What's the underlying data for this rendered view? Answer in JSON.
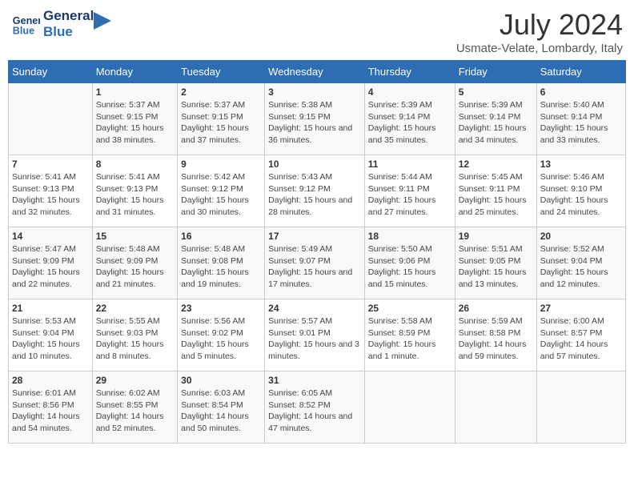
{
  "header": {
    "logo_line1": "General",
    "logo_line2": "Blue",
    "title": "July 2024",
    "subtitle": "Usmate-Velate, Lombardy, Italy"
  },
  "weekdays": [
    "Sunday",
    "Monday",
    "Tuesday",
    "Wednesday",
    "Thursday",
    "Friday",
    "Saturday"
  ],
  "weeks": [
    [
      {
        "day": "",
        "content": ""
      },
      {
        "day": "1",
        "content": "Sunrise: 5:37 AM\nSunset: 9:15 PM\nDaylight: 15 hours\nand 38 minutes."
      },
      {
        "day": "2",
        "content": "Sunrise: 5:37 AM\nSunset: 9:15 PM\nDaylight: 15 hours\nand 37 minutes."
      },
      {
        "day": "3",
        "content": "Sunrise: 5:38 AM\nSunset: 9:15 PM\nDaylight: 15 hours\nand 36 minutes."
      },
      {
        "day": "4",
        "content": "Sunrise: 5:39 AM\nSunset: 9:14 PM\nDaylight: 15 hours\nand 35 minutes."
      },
      {
        "day": "5",
        "content": "Sunrise: 5:39 AM\nSunset: 9:14 PM\nDaylight: 15 hours\nand 34 minutes."
      },
      {
        "day": "6",
        "content": "Sunrise: 5:40 AM\nSunset: 9:14 PM\nDaylight: 15 hours\nand 33 minutes."
      }
    ],
    [
      {
        "day": "7",
        "content": "Sunrise: 5:41 AM\nSunset: 9:13 PM\nDaylight: 15 hours\nand 32 minutes."
      },
      {
        "day": "8",
        "content": "Sunrise: 5:41 AM\nSunset: 9:13 PM\nDaylight: 15 hours\nand 31 minutes."
      },
      {
        "day": "9",
        "content": "Sunrise: 5:42 AM\nSunset: 9:12 PM\nDaylight: 15 hours\nand 30 minutes."
      },
      {
        "day": "10",
        "content": "Sunrise: 5:43 AM\nSunset: 9:12 PM\nDaylight: 15 hours\nand 28 minutes."
      },
      {
        "day": "11",
        "content": "Sunrise: 5:44 AM\nSunset: 9:11 PM\nDaylight: 15 hours\nand 27 minutes."
      },
      {
        "day": "12",
        "content": "Sunrise: 5:45 AM\nSunset: 9:11 PM\nDaylight: 15 hours\nand 25 minutes."
      },
      {
        "day": "13",
        "content": "Sunrise: 5:46 AM\nSunset: 9:10 PM\nDaylight: 15 hours\nand 24 minutes."
      }
    ],
    [
      {
        "day": "14",
        "content": "Sunrise: 5:47 AM\nSunset: 9:09 PM\nDaylight: 15 hours\nand 22 minutes."
      },
      {
        "day": "15",
        "content": "Sunrise: 5:48 AM\nSunset: 9:09 PM\nDaylight: 15 hours\nand 21 minutes."
      },
      {
        "day": "16",
        "content": "Sunrise: 5:48 AM\nSunset: 9:08 PM\nDaylight: 15 hours\nand 19 minutes."
      },
      {
        "day": "17",
        "content": "Sunrise: 5:49 AM\nSunset: 9:07 PM\nDaylight: 15 hours\nand 17 minutes."
      },
      {
        "day": "18",
        "content": "Sunrise: 5:50 AM\nSunset: 9:06 PM\nDaylight: 15 hours\nand 15 minutes."
      },
      {
        "day": "19",
        "content": "Sunrise: 5:51 AM\nSunset: 9:05 PM\nDaylight: 15 hours\nand 13 minutes."
      },
      {
        "day": "20",
        "content": "Sunrise: 5:52 AM\nSunset: 9:04 PM\nDaylight: 15 hours\nand 12 minutes."
      }
    ],
    [
      {
        "day": "21",
        "content": "Sunrise: 5:53 AM\nSunset: 9:04 PM\nDaylight: 15 hours\nand 10 minutes."
      },
      {
        "day": "22",
        "content": "Sunrise: 5:55 AM\nSunset: 9:03 PM\nDaylight: 15 hours\nand 8 minutes."
      },
      {
        "day": "23",
        "content": "Sunrise: 5:56 AM\nSunset: 9:02 PM\nDaylight: 15 hours\nand 5 minutes."
      },
      {
        "day": "24",
        "content": "Sunrise: 5:57 AM\nSunset: 9:01 PM\nDaylight: 15 hours\nand 3 minutes."
      },
      {
        "day": "25",
        "content": "Sunrise: 5:58 AM\nSunset: 8:59 PM\nDaylight: 15 hours\nand 1 minute."
      },
      {
        "day": "26",
        "content": "Sunrise: 5:59 AM\nSunset: 8:58 PM\nDaylight: 14 hours\nand 59 minutes."
      },
      {
        "day": "27",
        "content": "Sunrise: 6:00 AM\nSunset: 8:57 PM\nDaylight: 14 hours\nand 57 minutes."
      }
    ],
    [
      {
        "day": "28",
        "content": "Sunrise: 6:01 AM\nSunset: 8:56 PM\nDaylight: 14 hours\nand 54 minutes."
      },
      {
        "day": "29",
        "content": "Sunrise: 6:02 AM\nSunset: 8:55 PM\nDaylight: 14 hours\nand 52 minutes."
      },
      {
        "day": "30",
        "content": "Sunrise: 6:03 AM\nSunset: 8:54 PM\nDaylight: 14 hours\nand 50 minutes."
      },
      {
        "day": "31",
        "content": "Sunrise: 6:05 AM\nSunset: 8:52 PM\nDaylight: 14 hours\nand 47 minutes."
      },
      {
        "day": "",
        "content": ""
      },
      {
        "day": "",
        "content": ""
      },
      {
        "day": "",
        "content": ""
      }
    ]
  ]
}
